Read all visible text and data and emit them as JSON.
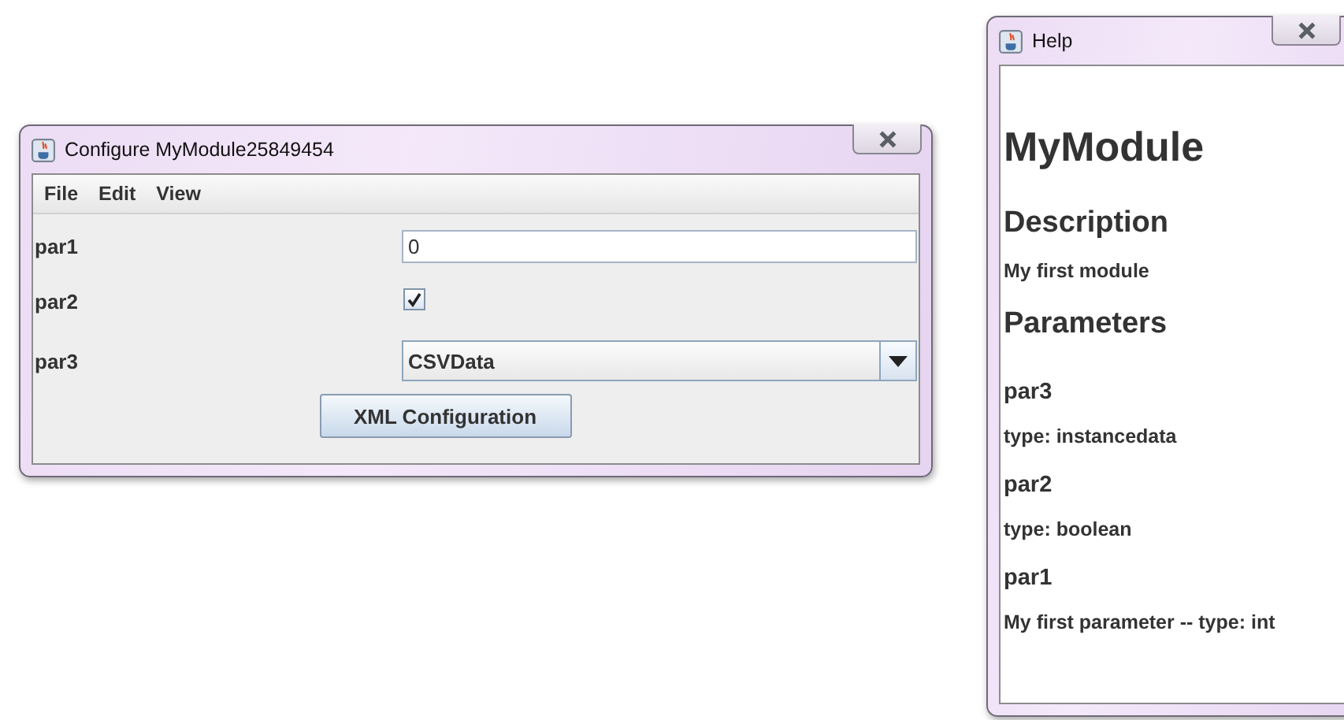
{
  "config_window": {
    "title": "Configure MyModule25849454",
    "menu": [
      "File",
      "Edit",
      "View"
    ],
    "params": [
      {
        "label": "par1",
        "kind": "text",
        "value": "0"
      },
      {
        "label": "par2",
        "kind": "checkbox",
        "checked": true
      },
      {
        "label": "par3",
        "kind": "combo",
        "value": "CSVData"
      }
    ],
    "button": "XML Configuration"
  },
  "help_window": {
    "title": "Help",
    "content": [
      {
        "kind": "h1",
        "text": "MyModule"
      },
      {
        "kind": "h2",
        "text": "Description"
      },
      {
        "kind": "p",
        "text": "My first module"
      },
      {
        "kind": "h2",
        "text": "Parameters"
      },
      {
        "kind": "h3",
        "text": "par3"
      },
      {
        "kind": "p",
        "text": "type: instancedata"
      },
      {
        "kind": "h3",
        "text": "par2"
      },
      {
        "kind": "p",
        "text": "type: boolean"
      },
      {
        "kind": "h3",
        "text": "par1"
      },
      {
        "kind": "p",
        "text": "My first parameter -- type: int"
      }
    ]
  }
}
